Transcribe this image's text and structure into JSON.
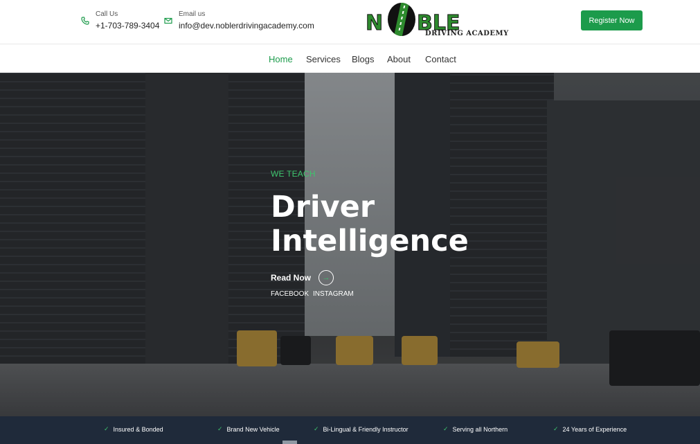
{
  "header": {
    "phone_label": "Call Us",
    "phone_value": "+1-703-789-3404",
    "email_label": "Email us",
    "email_value": "info@dev.noblerdrivingacademy.com",
    "logo_text_start": "N",
    "logo_text_end": "BLE",
    "logo_subtitle": "DRIVING ACADEMY",
    "register_label": "Register Now"
  },
  "nav": {
    "items": [
      "Home",
      "Services",
      "Blogs",
      "About",
      "Contact"
    ],
    "active": "Home"
  },
  "hero": {
    "eyebrow": "WE TEACH",
    "headline_line1": "Driver",
    "headline_line2": "Intelligence",
    "read_now": "Read Now",
    "social_facebook": "FACEBOOK",
    "social_instagram": "INSTAGRAM"
  },
  "features": [
    "Insured & Bonded",
    "Brand New Vehicle",
    "Bi-Lingual & Friendly Instructor",
    "Serving all Northern",
    "24 Years of Experience"
  ],
  "colors": {
    "accent": "#1c9b4b",
    "eyebrow": "#3ec46d",
    "features_bg": "#1f2a3a"
  }
}
